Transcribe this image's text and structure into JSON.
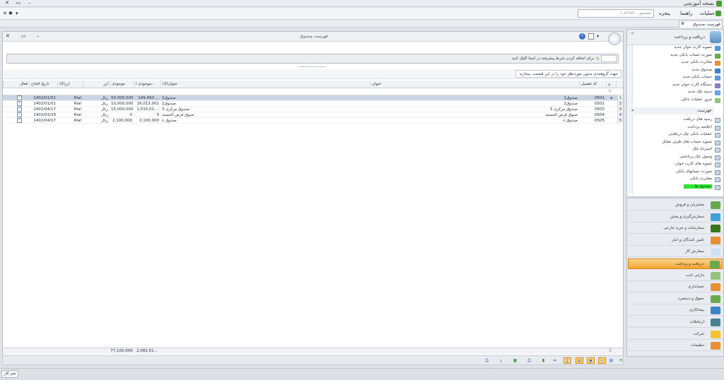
{
  "app": {
    "title": "نسخه آموزشی",
    "menu": [
      "عملیات",
      "راهنما",
      "پنجره"
    ],
    "search_placeholder": "جستجو... (Ctrl+-)"
  },
  "doc_tab": {
    "label": "فهرست صندوق"
  },
  "main": {
    "title": "فهرست صندوق",
    "filter_text": "برای اضافه کردن شرط پیشرفته در اینجا کلیک کنید",
    "group_hint": "جهت گروهبندی ستون موردنظر خود را در این قسمت بیندازید",
    "columns": {
      "code": "کد تفصیل",
      "title": "عنوان",
      "title2": "عنوان(2)",
      "balance_pct": "موجودی ا...",
      "balance": "موجودی",
      "currency": "ارز",
      "currency2": "ارز(2)",
      "open_date": "تاریخ افتتاح",
      "active": "فعال"
    },
    "rows": [
      {
        "num": "1",
        "code": "0501",
        "title": "صندوق1",
        "title2": "صندوق1",
        "balance_pct": "149,493....",
        "balance": "50,000,000",
        "currency": "ریال",
        "currency2": "Rial",
        "open_date": "1402/01/01",
        "active": "✓"
      },
      {
        "num": "2",
        "code": "0502",
        "title": "صندوق2",
        "title2": "صندوق2",
        "balance_pct": "16,013,001",
        "balance": "10,000,000",
        "currency": "ریال",
        "currency2": "Rial",
        "open_date": "1402/01/01",
        "active": "✓"
      },
      {
        "num": "3",
        "code": "0503",
        "title": "صندوق مرکزی 3",
        "title2": "صندوق مرکزی 3",
        "balance_pct": "1,515,01....",
        "balance": "15,000,000",
        "currency": "ریال",
        "currency2": "Rial",
        "open_date": "1402/04/17",
        "active": "✓"
      },
      {
        "num": "4",
        "code": "0504",
        "title": "صنوق قرض الحسنه",
        "title2": "صنوق قرض الحسنه",
        "balance_pct": "0",
        "balance": "0",
        "currency": "ریال",
        "currency2": "Rial",
        "open_date": "1402/03/29",
        "active": "✓"
      },
      {
        "num": "5",
        "code": "0505",
        "title": "صندوق ٤",
        "title2": "صندوق ٤",
        "balance_pct": "2,100,000",
        "balance": "2,100,000",
        "currency": "ریال",
        "currency2": "Rial",
        "open_date": "1402/04/17",
        "active": "✓"
      }
    ],
    "footer": {
      "balance_pct": "2,082,61...",
      "balance": "77,100,000"
    }
  },
  "sidebar": {
    "title": "دریافت و پرداخت",
    "top_items": [
      "تسویه کارت خوان جدید",
      "صورت حساب بانکی جدید",
      "مغایرت بانکی جدید",
      "صندوق جدید",
      "حساب بانکی جدید",
      "دستگاه کارت خوان جدید",
      "دسته چک جدید",
      "مرور عملیات بانکی"
    ],
    "list_title": "فهرست",
    "list_items": [
      "رسید های دریافت",
      "اعلامیه پرداخت",
      "عملیات بانکی چک دریافتنی",
      "تسویه حساب های طرف مقابل",
      "استرداد چک",
      "وصول چک پرداختنی",
      "تسویه های کارت خوان",
      "صورت حسابهای بانکی",
      "مغایرت بانکی",
      "صندوق ها"
    ]
  },
  "modules": [
    "مشتریان و فروش",
    "سفارش‌گیری و پخش",
    "سفارشات و خرید خارجی",
    "تامین کنندگان و انبار",
    "سفارش کار",
    "دریافت و پرداخت",
    "دارایی ثابت",
    "حسابداری",
    "حقوق و دستمزد",
    "پیمانکاری",
    "ارتباطات",
    "شرکت",
    "تنظیمات"
  ],
  "status": {
    "label": "میز کار"
  },
  "colors": {
    "accent": "#f3a52f",
    "selected_row": "#c9d5e3",
    "highlight": "#2ee82e"
  }
}
